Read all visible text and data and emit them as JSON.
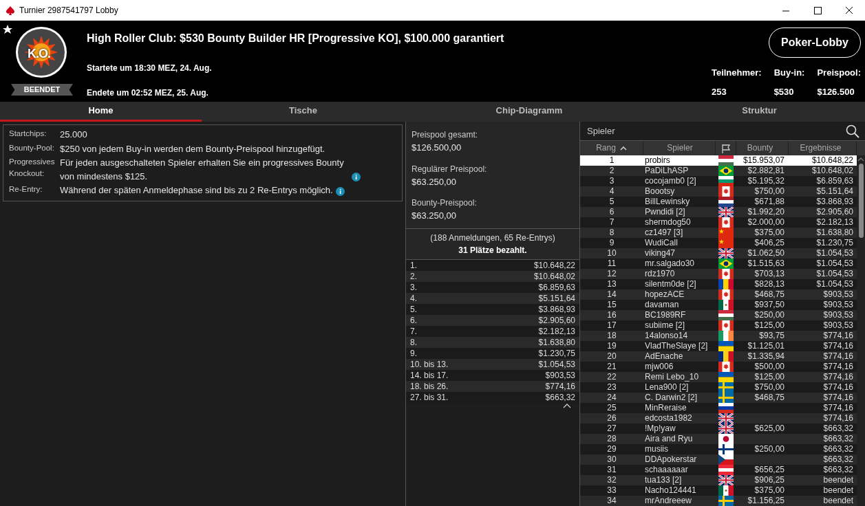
{
  "window": {
    "title": "Turnier 2987541797 Lobby"
  },
  "header": {
    "logo_text": "K.O.",
    "status_badge": "BEENDET",
    "title": "High Roller Club: $530 Bounty Builder HR [Progressive KO], $100.000 garantiert",
    "started": "Startete um 18:30 MEZ, 24. Aug.",
    "ended": "Endete um 02:52 MEZ, 25. Aug.",
    "lobby_button": "Poker-Lobby",
    "stats": [
      {
        "label": "Teilnehmer:",
        "value": "253"
      },
      {
        "label": "Buy-in:",
        "value": "$530"
      },
      {
        "label": "Preispool:",
        "value": "$126.500"
      }
    ]
  },
  "tabs": [
    {
      "label": "Home",
      "selected": true
    },
    {
      "label": "Tische",
      "selected": false
    },
    {
      "label": "Chip-Diagramm",
      "selected": false
    },
    {
      "label": "Struktur",
      "selected": false
    }
  ],
  "info": [
    {
      "label": "Startchips:",
      "value": "25.000",
      "info": false
    },
    {
      "label": "Bounty-Pool:",
      "value": "$250 von jedem Buy-in werden dem Bounty-Preispool hinzugefügt.",
      "info": false
    },
    {
      "label": "Progressives Knockout:",
      "value": "Für jeden ausgeschalteten Spieler erhalten Sie ein progressives Bounty von mindestens $125.",
      "info": true
    },
    {
      "label": "Re-Entry:",
      "value": "Während der späten Anmeldephase sind bis zu 2 Re-Entrys möglich.",
      "info": true
    }
  ],
  "pools": [
    {
      "label": "Preispool gesamt:",
      "value": "$126.500,00"
    },
    {
      "label": "Regulärer Preispool:",
      "value": "$63.250,00"
    },
    {
      "label": "Bounty-Preispool:",
      "value": "$63.250,00"
    }
  ],
  "entries": "(188 Anmeldungen, 65 Re-Entrys)",
  "paid": "31 Plätze bezahlt.",
  "payouts": [
    {
      "place": "1.",
      "amount": "$10.648,22"
    },
    {
      "place": "2.",
      "amount": "$10.648,02"
    },
    {
      "place": "3.",
      "amount": "$6.859,63"
    },
    {
      "place": "4.",
      "amount": "$5.151,64"
    },
    {
      "place": "5.",
      "amount": "$3.868,93"
    },
    {
      "place": "6.",
      "amount": "$2.905,60"
    },
    {
      "place": "7.",
      "amount": "$2.182,13"
    },
    {
      "place": "8.",
      "amount": "$1.638,80"
    },
    {
      "place": "9.",
      "amount": "$1.230,75"
    },
    {
      "place": "10. bis 13.",
      "amount": "$1.054,53"
    },
    {
      "place": "14. bis 17.",
      "amount": "$903,53"
    },
    {
      "place": "18. bis 26.",
      "amount": "$774,16"
    },
    {
      "place": "27. bis 31.",
      "amount": "$663,32"
    }
  ],
  "search": {
    "placeholder": "Spieler"
  },
  "table": {
    "columns": [
      {
        "kind": "text",
        "label": "Rang",
        "sorted": true
      },
      {
        "kind": "text",
        "label": "Spieler",
        "sorted": false
      },
      {
        "kind": "flag",
        "sorted": false
      },
      {
        "kind": "text",
        "label": "Bounty",
        "sorted": false
      },
      {
        "kind": "text",
        "label": "Ergebnisse",
        "sorted": false
      }
    ],
    "rows": [
      {
        "rank": "1",
        "player": "probirs",
        "flag": {
          "kind": "hu"
        },
        "bounty": "$15.953,07",
        "result": "$10.648,22",
        "selected": true
      },
      {
        "rank": "2",
        "player": "PaDiLhASP",
        "flag": {
          "kind": "br"
        },
        "bounty": "$2.882,81",
        "result": "$10.648,02",
        "selected": false
      },
      {
        "rank": "3",
        "player": "cocojamb0 [2]",
        "flag": {
          "kind": "bg"
        },
        "bounty": "$5.195,32",
        "result": "$6.859,63",
        "selected": false
      },
      {
        "rank": "4",
        "player": "Boootsy",
        "flag": {
          "kind": "ca"
        },
        "bounty": "$750,00",
        "result": "$5.151,64",
        "selected": false
      },
      {
        "rank": "5",
        "player": "BillLewinsky",
        "flag": {
          "kind": "nl"
        },
        "bounty": "$671,88",
        "result": "$3.868,93",
        "selected": false
      },
      {
        "rank": "6",
        "player": "Pwndidi [2]",
        "flag": {
          "kind": "gb"
        },
        "bounty": "$1.992,20",
        "result": "$2.905,60",
        "selected": false
      },
      {
        "rank": "7",
        "player": "shermdog50",
        "flag": {
          "kind": "ca"
        },
        "bounty": "$2.000,00",
        "result": "$2.182,13",
        "selected": false
      },
      {
        "rank": "8",
        "player": "cz1497 [3]",
        "flag": {
          "kind": "cn"
        },
        "bounty": "$375,00",
        "result": "$1.638,80",
        "selected": false
      },
      {
        "rank": "9",
        "player": "WudiCall",
        "flag": {
          "kind": "cn"
        },
        "bounty": "$406,25",
        "result": "$1.230,75",
        "selected": false
      },
      {
        "rank": "10",
        "player": "viking47",
        "flag": {
          "kind": "gb"
        },
        "bounty": "$1.062,50",
        "result": "$1.054,53",
        "selected": false
      },
      {
        "rank": "11",
        "player": "mr.salgado30",
        "flag": {
          "kind": "br"
        },
        "bounty": "$1.515,63",
        "result": "$1.054,53",
        "selected": false
      },
      {
        "rank": "12",
        "player": "rdz1970",
        "flag": {
          "kind": "ca"
        },
        "bounty": "$703,13",
        "result": "$1.054,53",
        "selected": false
      },
      {
        "rank": "13",
        "player": "silentm0de [2]",
        "flag": {
          "kind": "md"
        },
        "bounty": "$828,13",
        "result": "$1.054,53",
        "selected": false
      },
      {
        "rank": "14",
        "player": "hopezACE",
        "flag": {
          "kind": "ca"
        },
        "bounty": "$468,75",
        "result": "$903,53",
        "selected": false
      },
      {
        "rank": "15",
        "player": "davaman",
        "flag": {
          "kind": "mx"
        },
        "bounty": "$937,50",
        "result": "$903,53",
        "selected": false
      },
      {
        "rank": "16",
        "player": "BC1989RF",
        "flag": {
          "kind": "hu"
        },
        "bounty": "$250,00",
        "result": "$903,53",
        "selected": false
      },
      {
        "rank": "17",
        "player": "subiime [2]",
        "flag": {
          "kind": "ca"
        },
        "bounty": "$125,00",
        "result": "$903,53",
        "selected": false
      },
      {
        "rank": "18",
        "player": "14alonso14",
        "flag": {
          "kind": "ie"
        },
        "bounty": "$93,75",
        "result": "$774,16",
        "selected": false
      },
      {
        "rank": "19",
        "player": "VladTheSlaye [2]",
        "flag": {
          "kind": "ua"
        },
        "bounty": "$1.125,01",
        "result": "$774,16",
        "selected": false
      },
      {
        "rank": "20",
        "player": "AdEnache",
        "flag": {
          "kind": "ro"
        },
        "bounty": "$1.335,94",
        "result": "$774,16",
        "selected": false
      },
      {
        "rank": "21",
        "player": "mjw006",
        "flag": {
          "kind": "ca"
        },
        "bounty": "$500,00",
        "result": "$774,16",
        "selected": false
      },
      {
        "rank": "22",
        "player": "Remi Lebo_10",
        "flag": {
          "kind": "ua"
        },
        "bounty": "$125,00",
        "result": "$774,16",
        "selected": false
      },
      {
        "rank": "23",
        "player": "Lena900 [2]",
        "flag": {
          "kind": "se"
        },
        "bounty": "$750,00",
        "result": "$774,16",
        "selected": false
      },
      {
        "rank": "24",
        "player": "C. Darwin2 [2]",
        "flag": {
          "kind": "se"
        },
        "bounty": "$468,75",
        "result": "$774,16",
        "selected": false
      },
      {
        "rank": "25",
        "player": "MinReraise",
        "flag": {
          "kind": "ru"
        },
        "result": "$774,16",
        "selected": false
      },
      {
        "rank": "26",
        "player": "edcosta1982",
        "flag": {
          "kind": "gb"
        },
        "result": "$774,16",
        "selected": false
      },
      {
        "rank": "27",
        "player": "!Mp!yaw",
        "flag": {
          "kind": "gb"
        },
        "bounty": "$625,00",
        "result": "$663,32",
        "selected": false
      },
      {
        "rank": "28",
        "player": "Aira and Ryu",
        "flag": {
          "kind": "jp"
        },
        "result": "$663,32",
        "selected": false
      },
      {
        "rank": "29",
        "player": "musiis",
        "flag": {
          "kind": "fi"
        },
        "bounty": "$250,00",
        "result": "$663,32",
        "selected": false
      },
      {
        "rank": "30",
        "player": "DDApokerstar",
        "flag": {
          "kind": "cz"
        },
        "result": "$663,32",
        "selected": false
      },
      {
        "rank": "31",
        "player": "schaaaaaar",
        "flag": {
          "kind": "at"
        },
        "bounty": "$656,25",
        "result": "$663,32",
        "selected": false
      },
      {
        "rank": "32",
        "player": "tua133 [2]",
        "flag": {
          "kind": "gb"
        },
        "bounty": "$906,25",
        "result": "beendet",
        "selected": false
      },
      {
        "rank": "33",
        "player": "Nacho124441",
        "flag": {
          "kind": "mx"
        },
        "bounty": "$375,00",
        "result": "beendet",
        "selected": false
      },
      {
        "rank": "34",
        "player": "mrAndreeew",
        "flag": {
          "kind": "se"
        },
        "bounty": "$1.156,25",
        "result": "beendet",
        "selected": false
      }
    ]
  }
}
